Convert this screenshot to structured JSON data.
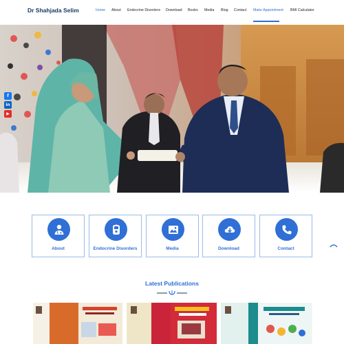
{
  "header": {
    "site_title": "Dr Shahjada Selim",
    "nav": [
      "Home",
      "About",
      "Endocrine Disorders",
      "Download",
      "Books",
      "Media",
      "Blog",
      "Contact",
      "Make Appointment",
      "BMI Calculator"
    ],
    "active_item": "Home"
  },
  "hero": {
    "image_description": "photo"
  },
  "social": {
    "icons": [
      "facebook-icon",
      "linkedin-icon",
      "youtube-icon"
    ],
    "labels": [
      "f",
      "in",
      "▶"
    ]
  },
  "cards": [
    {
      "label": "About",
      "icon": "doctor-icon"
    },
    {
      "label": "Endocrine Disorders",
      "icon": "glucometer-icon"
    },
    {
      "label": "Media",
      "icon": "media-icon"
    },
    {
      "label": "Download",
      "icon": "cloud-download-icon"
    },
    {
      "label": "Contact",
      "icon": "phone-icon"
    }
  ],
  "publications": {
    "heading": "Latest Publications",
    "books": [
      {
        "cover_color": "#f3ead8",
        "accent": "#d7412f"
      },
      {
        "cover_color": "#c9243a",
        "accent": "#f2c21d"
      },
      {
        "cover_color": "#eef6f5",
        "accent": "#1c8c8c"
      }
    ]
  },
  "colors": {
    "accent": "#2f6fd6",
    "facebook": "#1877f2",
    "linkedin": "#0a66c2",
    "youtube": "#e52d27",
    "title": "#16365f"
  }
}
